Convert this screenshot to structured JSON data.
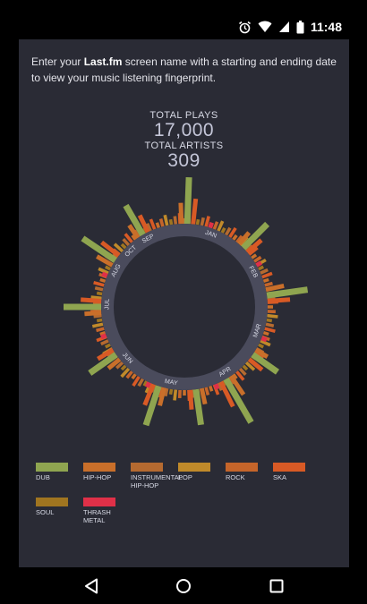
{
  "status": {
    "time": "11:48",
    "icons": [
      "alarm-icon",
      "wifi-icon",
      "signal-icon",
      "battery-icon"
    ]
  },
  "intro": {
    "prefix": "Enter your ",
    "brand": "Last.fm",
    "suffix": " screen name with a starting and ending date to view your music listening fingerprint."
  },
  "stats": {
    "plays_label": "TOTAL PLAYS",
    "plays_value": "17,000",
    "artists_label": "TOTAL ARTISTS",
    "artists_value": "309"
  },
  "months": [
    "JAN",
    "FEB",
    "MAR",
    "APR",
    "MAY",
    "JUN",
    "JUL",
    "AUG",
    "SEP",
    "OCT"
  ],
  "genres": [
    {
      "name": "DUB",
      "color": "#8fa550"
    },
    {
      "name": "HIP-HOP",
      "color": "#c96f2a"
    },
    {
      "name": "INSTRUMENTAL HIP-HOP",
      "color": "#b56a30"
    },
    {
      "name": "POP",
      "color": "#c08a2a"
    },
    {
      "name": "ROCK",
      "color": "#c5652a"
    },
    {
      "name": "SKA",
      "color": "#d85a25"
    },
    {
      "name": "SOUL",
      "color": "#a07520"
    },
    {
      "name": "THRASH METAL",
      "color": "#e03048"
    }
  ],
  "colors": {
    "background": "#2a2b35",
    "ring": "#4a4b5c",
    "text": "#d8dae6"
  },
  "navigation": {
    "icons": [
      "back-icon",
      "home-icon",
      "recents-icon"
    ]
  }
}
